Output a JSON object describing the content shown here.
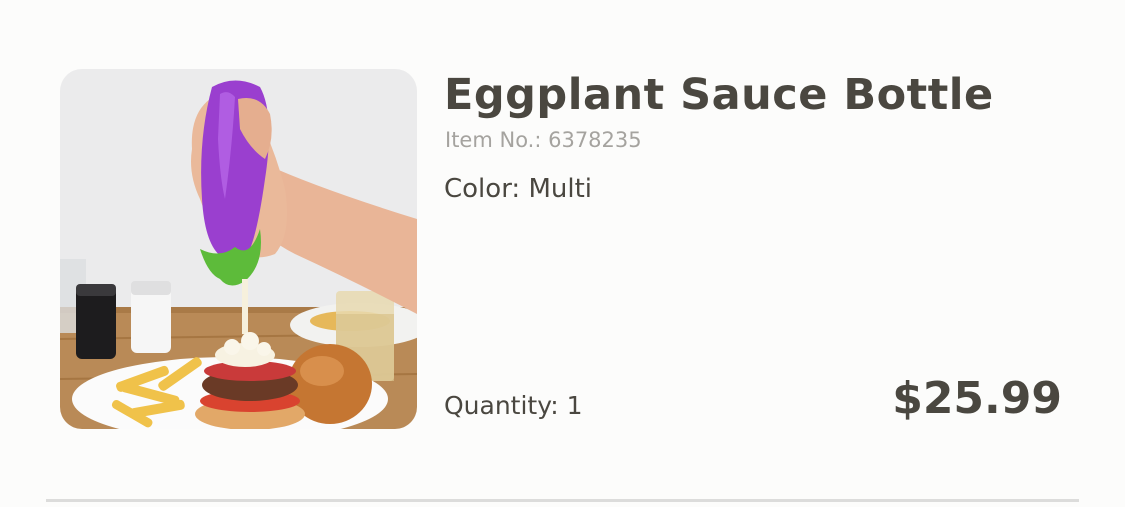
{
  "product": {
    "title": "Eggplant Sauce Bottle",
    "item_no": "Item No.: 6378235",
    "color": "Color: Multi",
    "quantity": "Quantity: 1",
    "price": "$25.99",
    "image_icon": "eggplant-sauce-bottle-photo"
  }
}
